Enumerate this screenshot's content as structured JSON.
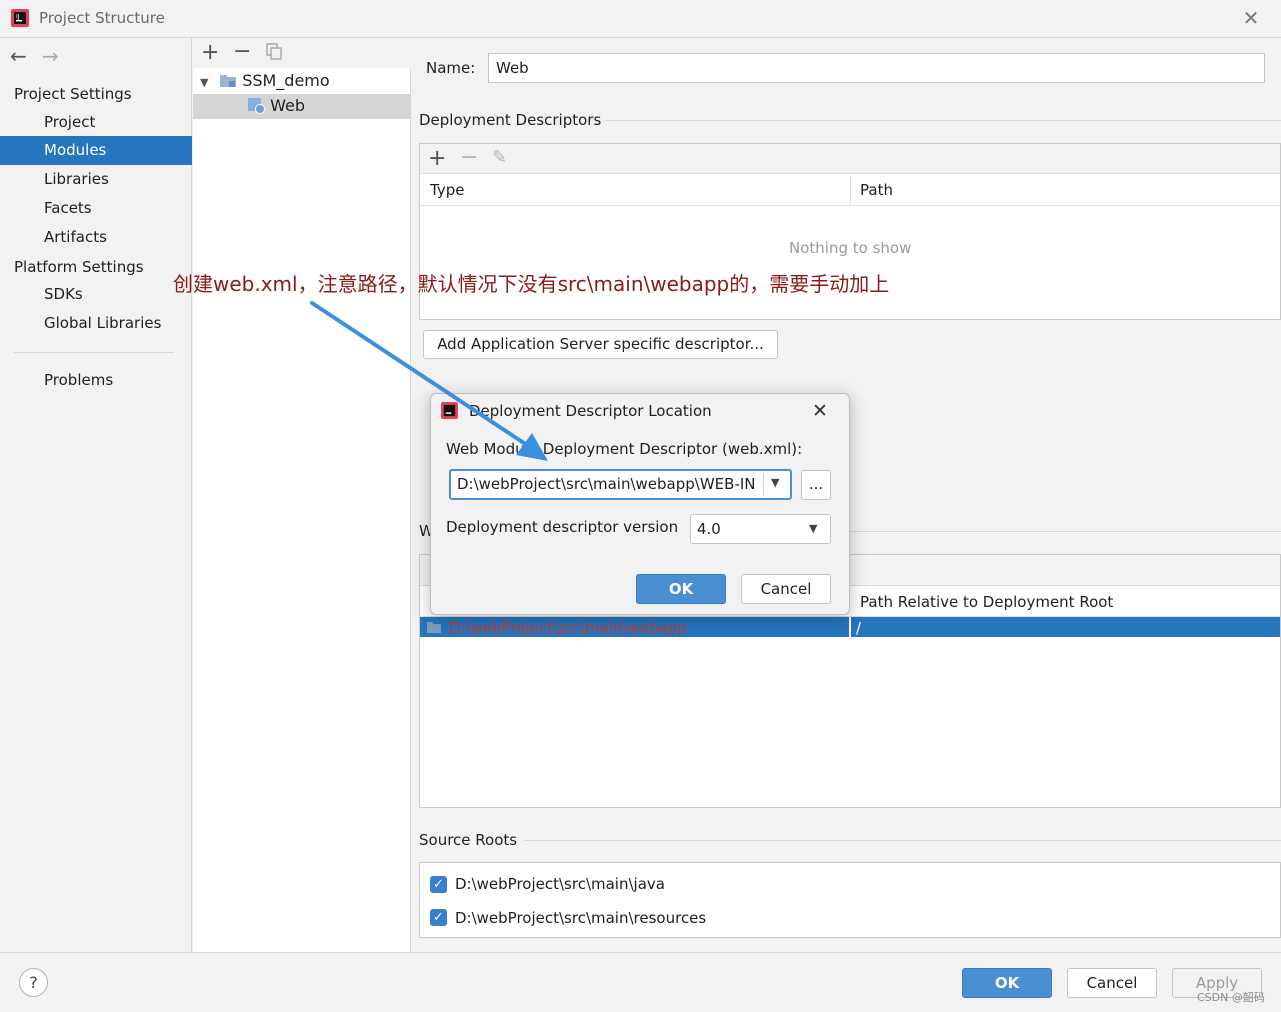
{
  "window": {
    "title": "Project Structure"
  },
  "nav": {
    "project_settings_label": "Project Settings",
    "project_settings_items": [
      "Project",
      "Modules",
      "Libraries",
      "Facets",
      "Artifacts"
    ],
    "platform_settings_label": "Platform Settings",
    "platform_settings_items": [
      "SDKs",
      "Global Libraries"
    ],
    "problems_label": "Problems",
    "selected": "Modules"
  },
  "modules": {
    "tree": [
      {
        "label": "SSM_demo",
        "level": 0,
        "expanded": true
      },
      {
        "label": "Web",
        "level": 1,
        "selected": true
      }
    ]
  },
  "detail": {
    "name_label": "Name:",
    "name_value": "Web",
    "deployment_descriptors_title": "Deployment Descriptors",
    "dd_columns": [
      "Type",
      "Path"
    ],
    "dd_empty_text": "Nothing to show",
    "add_server_button": "Add Application Server specific descriptor...",
    "web_resource_partial_label": "W",
    "wr_column_path_relative": "Path Relative to Deployment Root",
    "wr_row_dir": "D:\\webProject\\src\\main\\webapp",
    "wr_row_rel": "/",
    "source_roots_title": "Source Roots",
    "source_roots": [
      {
        "path": "D:\\webProject\\src\\main\\java",
        "checked": true
      },
      {
        "path": "D:\\webProject\\src\\main\\resources",
        "checked": true
      }
    ]
  },
  "dialog": {
    "title": "Deployment Descriptor Location",
    "path_label": "Web Module Deployment Descriptor (web.xml):",
    "path_value": "D:\\webProject\\src\\main\\webapp\\WEB-IN",
    "browse_label": "...",
    "version_label": "Deployment descriptor version",
    "version_value": "4.0",
    "ok_label": "OK",
    "cancel_label": "Cancel"
  },
  "footer": {
    "help_label": "?",
    "ok_label": "OK",
    "cancel_label": "Cancel",
    "apply_label": "Apply"
  },
  "annotation": {
    "text": "创建web.xml，注意路径，默认情况下没有src\\main\\webapp的，需要手动加上",
    "color": "#8b1a1a",
    "arrow_color": "#3b8fe0"
  },
  "watermark": "CSDN @韶码",
  "colors": {
    "selection": "#2675bf",
    "primary_button": "#4a8fd4"
  }
}
